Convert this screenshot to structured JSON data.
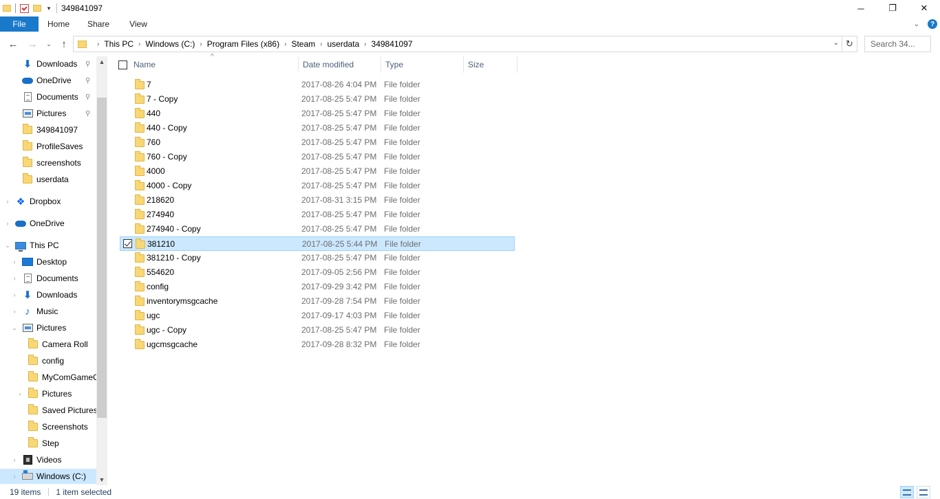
{
  "window": {
    "title": "349841097",
    "controls": [
      "minimize",
      "restore",
      "close"
    ]
  },
  "ribbon": {
    "tabs": [
      "File",
      "Home",
      "Share",
      "View"
    ]
  },
  "address": {
    "crumbs": [
      "This PC",
      "Windows (C:)",
      "Program Files (x86)",
      "Steam",
      "userdata",
      "349841097"
    ],
    "search_placeholder": "Search 34..."
  },
  "nav": {
    "items": [
      {
        "label": "Downloads",
        "icon": "download-icon",
        "pinned": true,
        "level": 1,
        "expand": ""
      },
      {
        "label": "OneDrive",
        "icon": "onedrive-icon",
        "pinned": true,
        "level": 1,
        "expand": ""
      },
      {
        "label": "Documents",
        "icon": "documents-icon",
        "pinned": true,
        "level": 1,
        "expand": ""
      },
      {
        "label": "Pictures",
        "icon": "pictures-icon",
        "pinned": true,
        "level": 1,
        "expand": ""
      },
      {
        "label": "349841097",
        "icon": "folder-icon",
        "pinned": false,
        "level": 1,
        "expand": ""
      },
      {
        "label": "ProfileSaves",
        "icon": "folder-icon",
        "pinned": false,
        "level": 1,
        "expand": ""
      },
      {
        "label": "screenshots",
        "icon": "folder-icon",
        "pinned": false,
        "level": 1,
        "expand": ""
      },
      {
        "label": "userdata",
        "icon": "folder-icon",
        "pinned": false,
        "level": 1,
        "expand": ""
      },
      {
        "label": "Dropbox",
        "icon": "dropbox-icon",
        "pinned": false,
        "level": 0,
        "expand": "collapsed"
      },
      {
        "label": "OneDrive",
        "icon": "onedrive-icon",
        "pinned": false,
        "level": 0,
        "expand": "collapsed"
      },
      {
        "label": "This PC",
        "icon": "this-pc-icon",
        "pinned": false,
        "level": 0,
        "expand": "expanded"
      },
      {
        "label": "Desktop",
        "icon": "desktop-icon",
        "pinned": false,
        "level": 1,
        "expand": "collapsed"
      },
      {
        "label": "Documents",
        "icon": "documents-icon",
        "pinned": false,
        "level": 1,
        "expand": "collapsed"
      },
      {
        "label": "Downloads",
        "icon": "download-icon",
        "pinned": false,
        "level": 1,
        "expand": "collapsed"
      },
      {
        "label": "Music",
        "icon": "music-icon",
        "pinned": false,
        "level": 1,
        "expand": "collapsed"
      },
      {
        "label": "Pictures",
        "icon": "pictures-icon",
        "pinned": false,
        "level": 1,
        "expand": "expanded"
      },
      {
        "label": "Camera Roll",
        "icon": "folder-icon",
        "pinned": false,
        "level": 2,
        "expand": ""
      },
      {
        "label": "config",
        "icon": "folder-icon",
        "pinned": false,
        "level": 2,
        "expand": ""
      },
      {
        "label": "MyComGameC",
        "icon": "folder-icon",
        "pinned": false,
        "level": 2,
        "expand": ""
      },
      {
        "label": "Pictures",
        "icon": "folder-icon",
        "pinned": false,
        "level": 2,
        "expand": "collapsed"
      },
      {
        "label": "Saved Pictures",
        "icon": "folder-icon",
        "pinned": false,
        "level": 2,
        "expand": ""
      },
      {
        "label": "Screenshots",
        "icon": "folder-icon",
        "pinned": false,
        "level": 2,
        "expand": ""
      },
      {
        "label": "Step",
        "icon": "folder-icon",
        "pinned": false,
        "level": 2,
        "expand": ""
      },
      {
        "label": "Videos",
        "icon": "videos-icon",
        "pinned": false,
        "level": 1,
        "expand": "collapsed"
      },
      {
        "label": "Windows (C:)",
        "icon": "drive-icon",
        "pinned": false,
        "level": 1,
        "expand": "collapsed",
        "selected": true
      }
    ]
  },
  "columns": {
    "name": "Name",
    "date": "Date modified",
    "type": "Type",
    "size": "Size"
  },
  "files": [
    {
      "name": "7",
      "date": "2017-08-26 4:04 PM",
      "type": "File folder"
    },
    {
      "name": "7 - Copy",
      "date": "2017-08-25 5:47 PM",
      "type": "File folder"
    },
    {
      "name": "440",
      "date": "2017-08-25 5:47 PM",
      "type": "File folder"
    },
    {
      "name": "440 - Copy",
      "date": "2017-08-25 5:47 PM",
      "type": "File folder"
    },
    {
      "name": "760",
      "date": "2017-08-25 5:47 PM",
      "type": "File folder"
    },
    {
      "name": "760 - Copy",
      "date": "2017-08-25 5:47 PM",
      "type": "File folder"
    },
    {
      "name": "4000",
      "date": "2017-08-25 5:47 PM",
      "type": "File folder"
    },
    {
      "name": "4000 - Copy",
      "date": "2017-08-25 5:47 PM",
      "type": "File folder"
    },
    {
      "name": "218620",
      "date": "2017-08-31 3:15 PM",
      "type": "File folder"
    },
    {
      "name": "274940",
      "date": "2017-08-25 5:47 PM",
      "type": "File folder"
    },
    {
      "name": "274940 - Copy",
      "date": "2017-08-25 5:47 PM",
      "type": "File folder"
    },
    {
      "name": "381210",
      "date": "2017-08-25 5:44 PM",
      "type": "File folder",
      "selected": true
    },
    {
      "name": "381210 - Copy",
      "date": "2017-08-25 5:47 PM",
      "type": "File folder"
    },
    {
      "name": "554620",
      "date": "2017-09-05 2:56 PM",
      "type": "File folder"
    },
    {
      "name": "config",
      "date": "2017-09-29 3:42 PM",
      "type": "File folder"
    },
    {
      "name": "inventorymsgcache",
      "date": "2017-09-28 7:54 PM",
      "type": "File folder"
    },
    {
      "name": "ugc",
      "date": "2017-09-17 4:03 PM",
      "type": "File folder"
    },
    {
      "name": "ugc - Copy",
      "date": "2017-08-25 5:47 PM",
      "type": "File folder"
    },
    {
      "name": "ugcmsgcache",
      "date": "2017-09-28 8:32 PM",
      "type": "File folder"
    }
  ],
  "status": {
    "count": "19 items",
    "selection": "1 item selected"
  },
  "colors": {
    "accent": "#1979ca",
    "selection": "#cce8ff",
    "folder": "#f8d775"
  }
}
